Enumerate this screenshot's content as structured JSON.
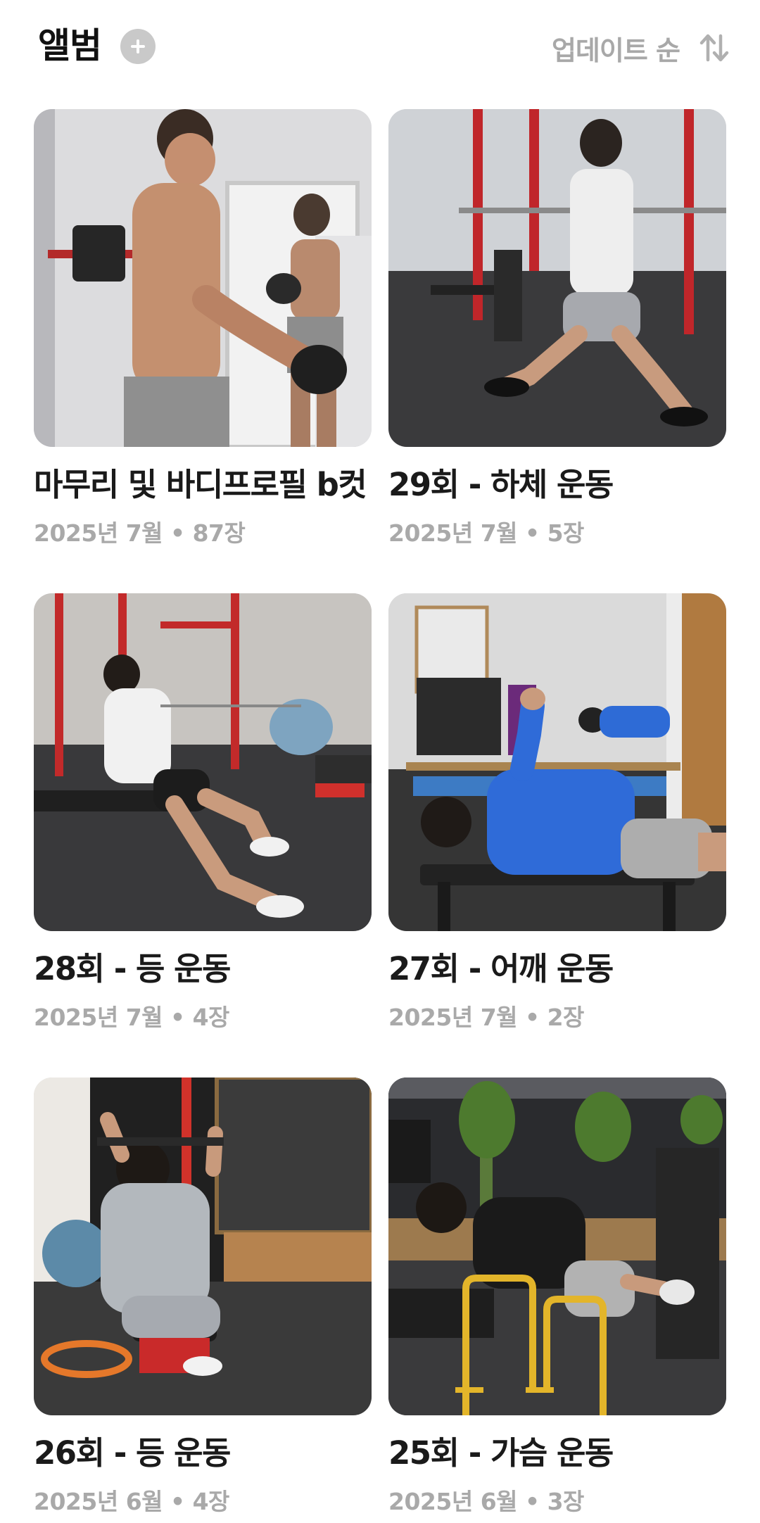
{
  "header": {
    "title": "앨범",
    "sort_label": "업데이트 순"
  },
  "colors": {
    "title": "#111111",
    "meta": "#a9a9a9",
    "add_button_bg": "#c9c9c9",
    "sort_label": "#a8a8a8"
  },
  "icons": {
    "add": "plus-icon",
    "sort": "sort-arrows-icon"
  },
  "albums": [
    {
      "title": "마무리 및 바디프로필 b컷",
      "date": "2025년 7월",
      "count": "87장",
      "meta": "2025년 7월 • 87장"
    },
    {
      "title": "29회 - 하체 운동",
      "date": "2025년 7월",
      "count": "5장",
      "meta": "2025년 7월 • 5장"
    },
    {
      "title": "28회 - 등 운동",
      "date": "2025년 7월",
      "count": "4장",
      "meta": "2025년 7월 • 4장"
    },
    {
      "title": "27회 - 어깨 운동",
      "date": "2025년 7월",
      "count": "2장",
      "meta": "2025년 7월 • 2장"
    },
    {
      "title": "26회 - 등 운동",
      "date": "2025년 6월",
      "count": "4장",
      "meta": "2025년 6월 • 4장"
    },
    {
      "title": "25회 - 가슴 운동",
      "date": "2025년 6월",
      "count": "3장",
      "meta": "2025년 6월 • 3장"
    }
  ]
}
